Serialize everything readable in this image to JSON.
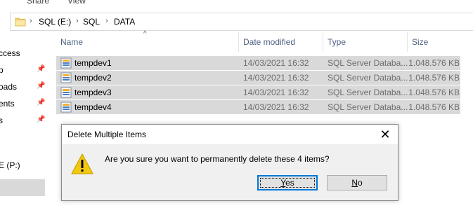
{
  "ribbon": {
    "tabs": [
      "Share",
      "View"
    ]
  },
  "address": {
    "crumbs": [
      "SQL (E:)",
      "SQL",
      "DATA"
    ],
    "separator": "›"
  },
  "sidebar": {
    "items": [
      {
        "label": "ccess",
        "pinned": false
      },
      {
        "label": "p",
        "pinned": true
      },
      {
        "label": "oads",
        "pinned": true
      },
      {
        "label": "ents",
        "pinned": true
      },
      {
        "label": "s",
        "pinned": true
      },
      {
        "label": "E (P:)",
        "pinned": false
      }
    ]
  },
  "columns": {
    "name": "Name",
    "date": "Date modified",
    "type": "Type",
    "size": "Size"
  },
  "files": [
    {
      "name": "tempdev1",
      "date": "14/03/2021 16:32",
      "type": "SQL Server Databa...",
      "size": "1.048.576 KB"
    },
    {
      "name": "tempdev2",
      "date": "14/03/2021 16:32",
      "type": "SQL Server Databa...",
      "size": "1.048.576 KB"
    },
    {
      "name": "tempdev3",
      "date": "14/03/2021 16:32",
      "type": "SQL Server Databa...",
      "size": "1.048.576 KB"
    },
    {
      "name": "tempdev4",
      "date": "14/03/2021 16:32",
      "type": "SQL Server Databa...",
      "size": "1.048.576 KB"
    }
  ],
  "dialog": {
    "title": "Delete Multiple Items",
    "message": "Are you sure you want to permanently delete these 4 items?",
    "yes_mnemonic": "Y",
    "yes_rest": "es",
    "no_mnemonic": "N",
    "no_rest": "o",
    "close_glyph": "✕",
    "icon": "warning-icon"
  },
  "colors": {
    "selection": "#d9d9d9",
    "header_text": "#4d6082",
    "accent": "#0078d7",
    "warning": "#f2c811"
  }
}
